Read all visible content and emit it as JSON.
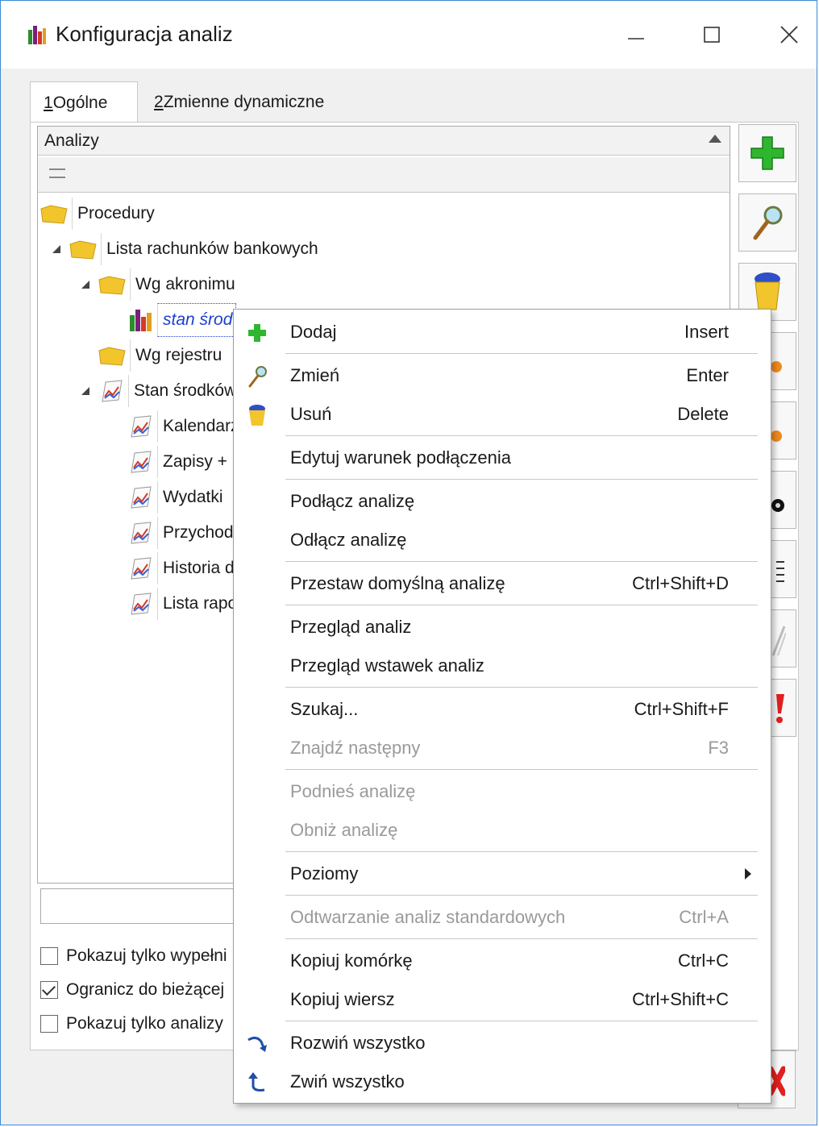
{
  "window": {
    "title": "Konfiguracja analiz"
  },
  "tabs": [
    {
      "underline": "1",
      "label": " Ogólne"
    },
    {
      "underline": "2",
      "label": " Zmienne dynamiczne"
    }
  ],
  "grid": {
    "header": "Analizy"
  },
  "tree": [
    {
      "label": "Procedury"
    },
    {
      "label": "Lista rachunków bankowych"
    },
    {
      "label": "Wg akronimu"
    },
    {
      "label": "stan środ"
    },
    {
      "label": "Wg rejestru"
    },
    {
      "label": "Stan środków"
    },
    {
      "label": "Kalendarz"
    },
    {
      "label": "Zapisy +"
    },
    {
      "label": "Wydatki"
    },
    {
      "label": "Przychod"
    },
    {
      "label": "Historia d"
    },
    {
      "label": "Lista rapo"
    }
  ],
  "search": {
    "value": ""
  },
  "checkboxes": [
    {
      "label": "Pokazuj tylko wypełni",
      "checked": false
    },
    {
      "label": "Ogranicz do bieżącej",
      "checked": true
    },
    {
      "label": "Pokazuj tylko analizy",
      "checked": false
    }
  ],
  "side_buttons": [
    {
      "icon": "plus-icon"
    },
    {
      "icon": "magnifier-icon"
    },
    {
      "icon": "trash-icon"
    },
    {
      "icon": "pin-icon"
    },
    {
      "icon": "pin-icon"
    },
    {
      "icon": "binoculars-icon"
    },
    {
      "icon": "list-icon"
    },
    {
      "icon": "pen-icon"
    },
    {
      "icon": "exclamation-icon"
    },
    {
      "icon": "close-icon"
    }
  ],
  "context_menu": {
    "items": [
      {
        "label": "Dodaj",
        "shortcut": "Insert",
        "icon": "plus-icon"
      },
      {
        "label": "Zmień",
        "shortcut": "Enter",
        "icon": "magnifier-icon"
      },
      {
        "label": "Usuń",
        "shortcut": "Delete",
        "icon": "trash-icon"
      },
      {
        "label": "Edytuj warunek podłączenia",
        "shortcut": ""
      },
      {
        "label": "Podłącz analizę",
        "shortcut": ""
      },
      {
        "label": "Odłącz analizę",
        "shortcut": ""
      },
      {
        "label": "Przestaw domyślną analizę",
        "shortcut": "Ctrl+Shift+D"
      },
      {
        "label": "Przegląd analiz",
        "shortcut": ""
      },
      {
        "label": "Przegląd wstawek analiz",
        "shortcut": ""
      },
      {
        "label": "Szukaj...",
        "shortcut": "Ctrl+Shift+F"
      },
      {
        "label": "Znajdź następny",
        "shortcut": "F3",
        "disabled": true
      },
      {
        "label": "Podnieś analizę",
        "shortcut": "",
        "disabled": true
      },
      {
        "label": "Obniż analizę",
        "shortcut": "",
        "disabled": true
      },
      {
        "label": "Poziomy",
        "shortcut": "",
        "submenu": true
      },
      {
        "label": "Odtwarzanie analiz standardowych",
        "shortcut": "Ctrl+A",
        "disabled": true
      },
      {
        "label": "Kopiuj komórkę",
        "shortcut": "Ctrl+C"
      },
      {
        "label": "Kopiuj wiersz",
        "shortcut": "Ctrl+Shift+C"
      },
      {
        "label": "Rozwiń wszystko",
        "shortcut": "",
        "icon": "expand-all-icon"
      },
      {
        "label": "Zwiń wszystko",
        "shortcut": "",
        "icon": "collapse-all-icon"
      }
    ]
  },
  "colors": {
    "accent": "#3c8ad6",
    "selection_text": "#1c3fd0",
    "disabled_text": "#9a9a9a"
  }
}
